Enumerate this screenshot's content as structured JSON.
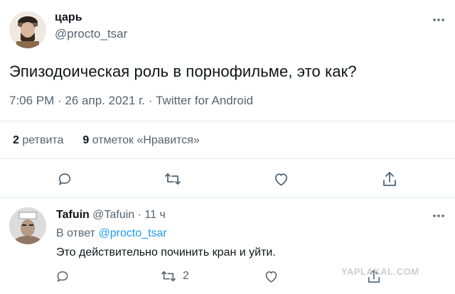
{
  "tweet": {
    "author_name": "царь",
    "author_handle": "@procto_tsar",
    "text": "Эпизодоическая роль в порнофильме, это как?",
    "meta": "7:06 PM · 26 апр. 2021 г. · Twitter for Android",
    "retweets_count": "2",
    "retweets_label": "ретвита",
    "likes_count": "9",
    "likes_label": "отметок «Нравится»",
    "actions": [
      "reply-icon",
      "retweet-icon",
      "like-icon",
      "share-icon"
    ]
  },
  "reply": {
    "author_name": "Tafuin",
    "author_handle": "@Tafuin",
    "time": "· 11 ч",
    "replying_to_prefix": "В ответ",
    "replying_to_handle": "@procto_tsar",
    "text": "Это действительно починить кран и уйти.",
    "retweet_count": "2",
    "actions": [
      "reply-icon",
      "retweet-icon",
      "like-icon",
      "share-icon"
    ]
  },
  "watermark": "YAPLAKAL.COM",
  "colors": {
    "accent": "#1d9bf0",
    "muted": "#536471",
    "divider": "#e6ecf0"
  }
}
